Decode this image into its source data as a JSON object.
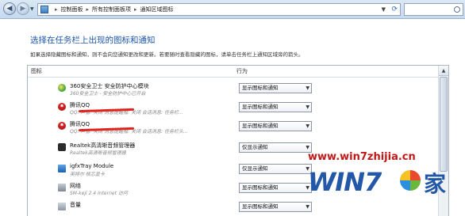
{
  "breadcrumbs": [
    "控制面板",
    "所有控制面板项",
    "通知区域图标"
  ],
  "heading": "选择在任务栏上出现的图标和通知",
  "description": "如果选择隐藏图标和通知，则不会向您通知更改和更新。若要随时查看隐藏的图标，请单击任务栏上通知区域旁的箭头。",
  "columns": {
    "icons": "图标",
    "behavior": "行为"
  },
  "rows": [
    {
      "icon": "shield-360-icon",
      "name": "360安全卫士 安全防护中心模块",
      "sub": "360安全卫士 - 安全防护中心已开启",
      "behavior": "显示图标和通知"
    },
    {
      "icon": "qq-penguin-icon",
      "name": "腾讯QQ",
      "sub": "QQ: 声音: 关闭 消息提醒框: 关闭 会话消息: 任务栏...",
      "behavior": "显示图标和通知",
      "redacted": true
    },
    {
      "icon": "qq-penguin-icon",
      "name": "腾讯QQ",
      "sub": "QQ: 声音: 关闭 消息提醒框: 关闭 会话消息: 任务栏头...",
      "behavior": "显示图标和通知",
      "redacted": true
    },
    {
      "icon": "realtek-audio-icon",
      "name": "Realtek高清晰音频管理器",
      "sub": "Realtek高清晰音频管理器",
      "behavior": "仅显示通知"
    },
    {
      "icon": "intel-graphics-icon",
      "name": "igfxTray Module",
      "sub": "英特尔 核芯显卡",
      "behavior": "仅显示通知"
    },
    {
      "icon": "network-icon",
      "name": "网络",
      "sub": "SM-keji 2.4 Internet 访问",
      "behavior": "显示图标和通知"
    },
    {
      "icon": "volume-icon",
      "name": "音量",
      "sub": "",
      "behavior": "显示图标和通知"
    }
  ],
  "watermark": {
    "url": "www.win7zhijia.cn",
    "logo": "WIN7",
    "logo_suffix": "家"
  }
}
